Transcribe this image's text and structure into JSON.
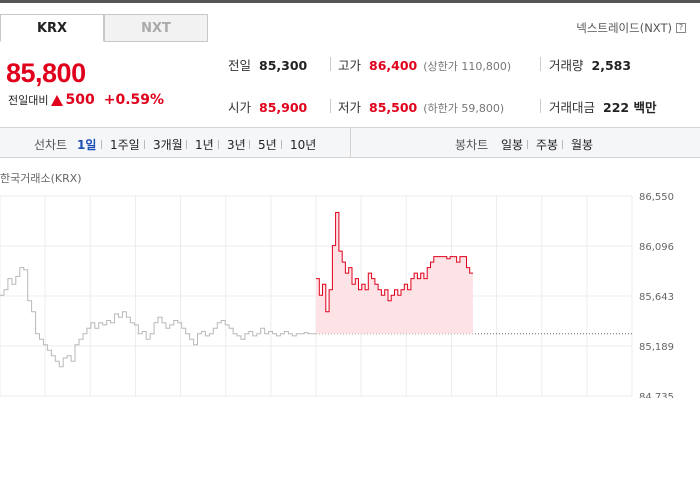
{
  "tabs": {
    "krx": "KRX",
    "nxt": "NXT"
  },
  "nxt_link": "넥스트레이드(NXT)",
  "help_glyph": "?",
  "price": {
    "current": "85,800",
    "change_label": "전일대비",
    "change_value": "500",
    "change_pct": "+0.59%",
    "direction": "up"
  },
  "stats": {
    "prev_close": {
      "label": "전일",
      "value": "85,300"
    },
    "high": {
      "label": "고가",
      "value": "86,400",
      "sub": "(상한가 110,800)"
    },
    "volume": {
      "label": "거래량",
      "value": "2,583"
    },
    "open": {
      "label": "시가",
      "value": "85,900"
    },
    "low": {
      "label": "저가",
      "value": "85,500",
      "sub": "(하한가 59,800)"
    },
    "amount": {
      "label": "거래대금",
      "value": "222 백만"
    }
  },
  "toolbar": {
    "line_label": "선차트",
    "line_periods": [
      "1일",
      "1주일",
      "3개월",
      "1년",
      "3년",
      "5년",
      "10년"
    ],
    "active_period": "1일",
    "candle_label": "봉차트",
    "candle_periods": [
      "일봉",
      "주봉",
      "월봉"
    ]
  },
  "colors": {
    "up": "#e0001b",
    "link_active": "#1b4fb5",
    "fill": "#fde3e6",
    "ref_line": "#666666"
  },
  "chart_data": {
    "type": "line",
    "title": "한국거래소(KRX)",
    "y_ticks": [
      "86,550",
      "86,096",
      "85,643",
      "85,189",
      "84,735"
    ],
    "ylim": [
      84735,
      86550
    ],
    "reference_value": 85300,
    "grid": true,
    "series": [
      {
        "style": "gray",
        "values": [
          85650,
          85700,
          85800,
          85750,
          85820,
          85900,
          85880,
          85600,
          85500,
          85300,
          85250,
          85200,
          85150,
          85100,
          85050,
          85000,
          85080,
          85100,
          85050,
          85200,
          85250,
          85300,
          85350,
          85400,
          85350,
          85400,
          85380,
          85420,
          85400,
          85480,
          85450,
          85500,
          85450,
          85400,
          85380,
          85300,
          85320,
          85250,
          85300,
          85400,
          85450,
          85400,
          85350,
          85380,
          85420,
          85400,
          85350,
          85300,
          85250,
          85200,
          85300,
          85320,
          85280,
          85300,
          85350,
          85400,
          85420,
          85380,
          85350,
          85300,
          85280,
          85250,
          85300,
          85320,
          85280,
          85300,
          85350,
          85300,
          85320,
          85300,
          85280,
          85300,
          85320,
          85300,
          85280,
          85300,
          85300,
          85310,
          85300,
          85300
        ]
      },
      {
        "style": "red",
        "values": [
          85800,
          85650,
          85750,
          85500,
          85700,
          86100,
          86400,
          86050,
          85950,
          85850,
          85900,
          85750,
          85800,
          85700,
          85750,
          85700,
          85850,
          85800,
          85750,
          85700,
          85650,
          85700,
          85600,
          85650,
          85700,
          85650,
          85700,
          85750,
          85700,
          85800,
          85850,
          85800,
          85850,
          85800,
          85900,
          85950,
          86000,
          86000,
          86000,
          86000,
          85980,
          86000,
          86000,
          85950,
          86000,
          86000,
          85900,
          85850
        ]
      }
    ]
  }
}
